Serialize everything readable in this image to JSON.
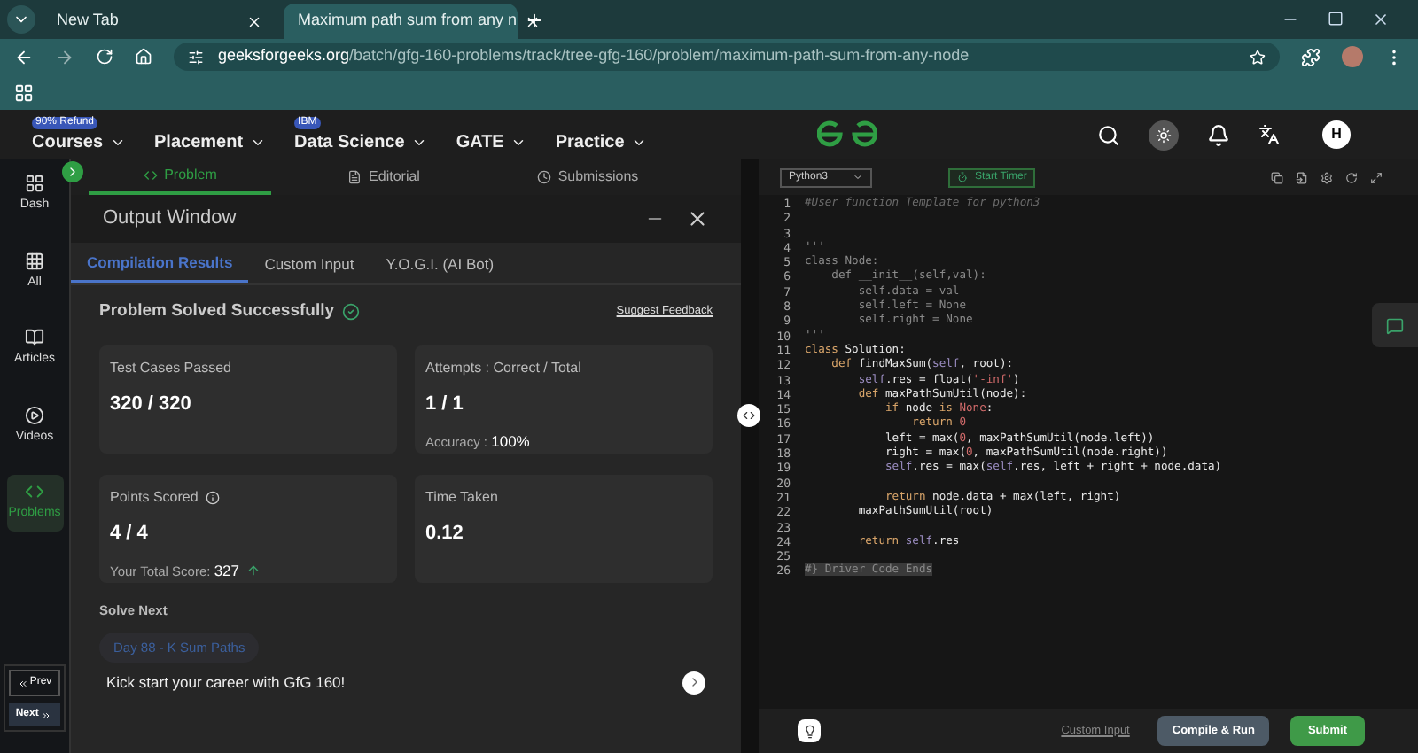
{
  "browser": {
    "tabs": [
      {
        "title": "New Tab",
        "selected": false
      },
      {
        "title": "Maximum path sum from any n",
        "selected": true
      }
    ],
    "url": {
      "domain": "geeksforgeeks.org",
      "path": "/batch/gfg-160-problems/track/tree-gfg-160/problem/maximum-path-sum-from-any-node"
    },
    "profile_photo": true
  },
  "nav": {
    "items": [
      {
        "label": "Courses",
        "badge": "90% Refund"
      },
      {
        "label": "Placement"
      },
      {
        "label": "Data Science",
        "badge": "IBM"
      },
      {
        "label": "GATE"
      },
      {
        "label": "Practice"
      }
    ],
    "avatar": "H"
  },
  "sidebar": {
    "items": [
      {
        "label": "Dash",
        "selected": false
      },
      {
        "label": "All",
        "selected": false
      },
      {
        "label": "Articles",
        "selected": false
      },
      {
        "label": "Videos",
        "selected": false
      },
      {
        "label": "Problems",
        "selected": true
      }
    ],
    "prev": "Prev",
    "next": "Next"
  },
  "problem_tabs": [
    {
      "label": "Problem",
      "selected": true
    },
    {
      "label": "Editorial",
      "selected": false
    },
    {
      "label": "Submissions",
      "selected": false
    }
  ],
  "output_window": {
    "title": "Output Window",
    "tabs": [
      {
        "label": "Compilation Results",
        "selected": true
      },
      {
        "label": "Custom Input",
        "selected": false
      },
      {
        "label": "Y.O.G.I. (AI Bot)",
        "selected": false
      }
    ],
    "status": "Problem Solved Successfully",
    "feedback_link": "Suggest Feedback",
    "cards": [
      {
        "title": "Test Cases Passed",
        "value": "320 / 320"
      },
      {
        "title": "Attempts : Correct / Total",
        "value": "1 / 1",
        "note_label": "Accuracy :",
        "note_value": "100%"
      },
      {
        "title": "Points Scored",
        "value": "4 / 4",
        "info": true,
        "note_label": "Your Total Score:",
        "note_value": "327",
        "trend_up": true
      },
      {
        "title": "Time Taken",
        "value": "0.12"
      }
    ],
    "solve_next_heading": "Solve Next",
    "next_problem": "Day 88 - K Sum Paths",
    "promo": "Kick start your career with GfG 160!"
  },
  "editor": {
    "language": "Python3",
    "timer": "Start Timer",
    "lines": [
      {
        "number": "1",
        "segments": [
          {
            "kind": "comment",
            "text": "#User function Template for python3"
          }
        ]
      },
      {
        "number": "2"
      },
      {
        "number": "3"
      },
      {
        "number": "4",
        "segments": [
          {
            "kind": "dim",
            "text": "'''"
          }
        ]
      },
      {
        "number": "5",
        "segments": [
          {
            "kind": "dim",
            "text": "class Node:"
          }
        ]
      },
      {
        "number": "6",
        "segments": [
          {
            "kind": "dim",
            "text": "    def __init__(self,val):"
          }
        ]
      },
      {
        "number": "7",
        "segments": [
          {
            "kind": "dim",
            "text": "        self.data = val"
          }
        ]
      },
      {
        "number": "8",
        "segments": [
          {
            "kind": "dim",
            "text": "        self.left = None"
          }
        ]
      },
      {
        "number": "9",
        "segments": [
          {
            "kind": "dim",
            "text": "        self.right = None"
          }
        ]
      },
      {
        "number": "10",
        "segments": [
          {
            "kind": "dim",
            "text": "'''"
          }
        ]
      },
      {
        "number": "11",
        "segments": [
          {
            "kind": "keyword",
            "text": "class "
          },
          {
            "kind": "plain",
            "text": "Solution:"
          }
        ]
      },
      {
        "number": "12",
        "segments": [
          {
            "kind": "keyword",
            "text": "    def "
          },
          {
            "kind": "plain",
            "text": "findMaxSum("
          },
          {
            "kind": "self",
            "text": "self"
          },
          {
            "kind": "plain",
            "text": ", root):"
          }
        ]
      },
      {
        "number": "13",
        "segments": [
          {
            "kind": "self",
            "text": "        self"
          },
          {
            "kind": "plain",
            "text": ".res = float("
          },
          {
            "kind": "string",
            "text": "'-inf'"
          },
          {
            "kind": "plain",
            "text": ")"
          }
        ]
      },
      {
        "number": "14",
        "segments": [
          {
            "kind": "keyword",
            "text": "        def "
          },
          {
            "kind": "plain",
            "text": "maxPathSumUtil(node):"
          }
        ]
      },
      {
        "number": "15",
        "segments": [
          {
            "kind": "keyword",
            "text": "            if "
          },
          {
            "kind": "plain",
            "text": "node "
          },
          {
            "kind": "keyword",
            "text": "is "
          },
          {
            "kind": "string",
            "text": "None"
          },
          {
            "kind": "plain",
            "text": ":"
          }
        ]
      },
      {
        "number": "16",
        "segments": [
          {
            "kind": "keyword",
            "text": "                return "
          },
          {
            "kind": "string",
            "text": "0"
          }
        ]
      },
      {
        "number": "17",
        "segments": [
          {
            "kind": "plain",
            "text": "            left = max("
          },
          {
            "kind": "string",
            "text": "0"
          },
          {
            "kind": "plain",
            "text": ", maxPathSumUtil(node.left))"
          }
        ]
      },
      {
        "number": "18",
        "segments": [
          {
            "kind": "plain",
            "text": "            right = max("
          },
          {
            "kind": "string",
            "text": "0"
          },
          {
            "kind": "plain",
            "text": ", maxPathSumUtil(node.right))"
          }
        ]
      },
      {
        "number": "19",
        "segments": [
          {
            "kind": "self",
            "text": "            self"
          },
          {
            "kind": "plain",
            "text": ".res = max("
          },
          {
            "kind": "self",
            "text": "self"
          },
          {
            "kind": "plain",
            "text": ".res, left + right + node.data)"
          }
        ]
      },
      {
        "number": "20"
      },
      {
        "number": "21",
        "segments": [
          {
            "kind": "keyword",
            "text": "            return "
          },
          {
            "kind": "plain",
            "text": "node.data + max(left, right)"
          }
        ]
      },
      {
        "number": "22",
        "segments": [
          {
            "kind": "plain",
            "text": "        maxPathSumUtil(root)"
          }
        ]
      },
      {
        "number": "23"
      },
      {
        "number": "24",
        "segments": [
          {
            "kind": "keyword",
            "text": "        return "
          },
          {
            "kind": "self",
            "text": "self"
          },
          {
            "kind": "plain",
            "text": ".res"
          }
        ]
      },
      {
        "number": "25"
      },
      {
        "number": "26",
        "segments": [
          {
            "kind": "selected",
            "text": "#} Driver Code Ends"
          }
        ]
      }
    ],
    "custom_input": "Custom Input",
    "compile": "Compile & Run",
    "submit": "Submit"
  }
}
